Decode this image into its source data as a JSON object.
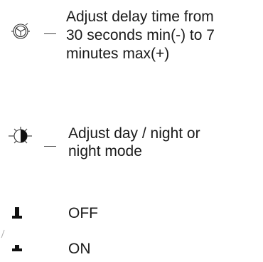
{
  "legend": {
    "delay": {
      "icon": "clock-dial-icon",
      "lines": [
        "Adjust delay time from",
        "30 seconds min(-) to 7",
        "minutes max(+)"
      ]
    },
    "daynight": {
      "icon": "day-night-dial-icon",
      "lines": [
        "Adjust day / night or",
        "night mode"
      ]
    },
    "off": {
      "icon": "switch-off-icon",
      "label": "OFF"
    },
    "on": {
      "icon": "switch-on-icon",
      "label": "ON"
    }
  }
}
